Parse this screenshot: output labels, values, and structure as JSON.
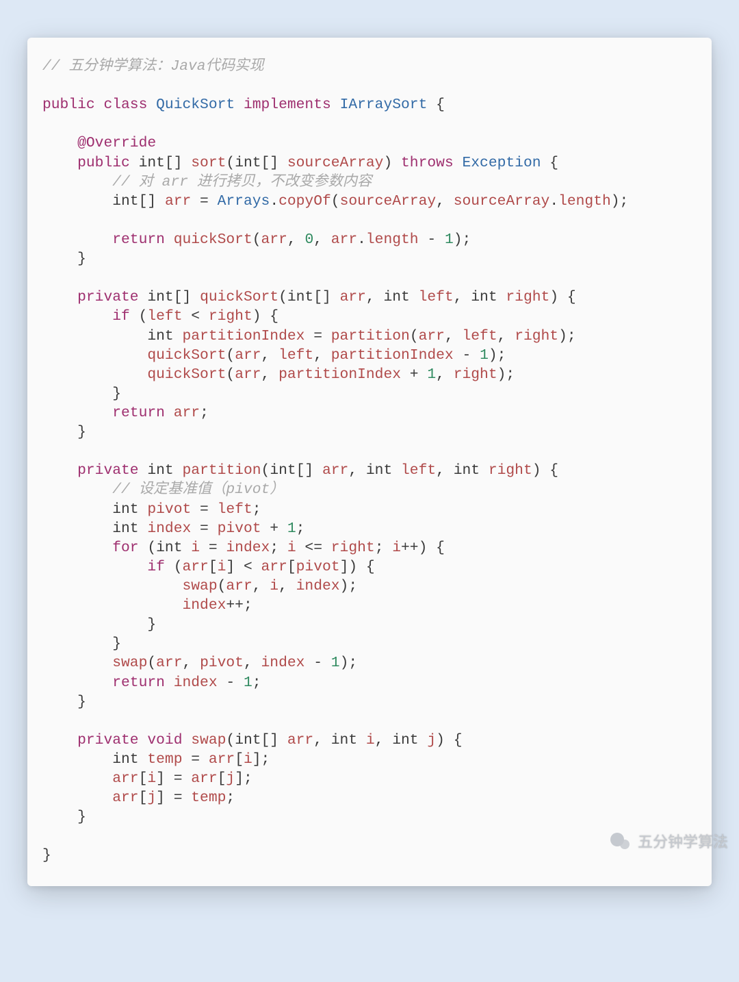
{
  "footer": {
    "brand": "五分钟学算法"
  },
  "code": {
    "lines": [
      [
        {
          "t": "// 五分钟学算法：Java代码实现",
          "c": "cm"
        }
      ],
      [],
      [
        {
          "t": "public",
          "c": "kw"
        },
        {
          "t": " "
        },
        {
          "t": "class",
          "c": "kw"
        },
        {
          "t": " "
        },
        {
          "t": "QuickSort",
          "c": "fn"
        },
        {
          "t": " "
        },
        {
          "t": "implements",
          "c": "kw"
        },
        {
          "t": " "
        },
        {
          "t": "IArraySort",
          "c": "fn"
        },
        {
          "t": " {",
          "c": "op"
        }
      ],
      [],
      [
        {
          "t": "    "
        },
        {
          "t": "@Override",
          "c": "ann"
        }
      ],
      [
        {
          "t": "    "
        },
        {
          "t": "public",
          "c": "kw"
        },
        {
          "t": " "
        },
        {
          "t": "int",
          "c": "ty"
        },
        {
          "t": "[] ",
          "c": "op"
        },
        {
          "t": "sort",
          "c": "fnc"
        },
        {
          "t": "(",
          "c": "op"
        },
        {
          "t": "int",
          "c": "ty"
        },
        {
          "t": "[] ",
          "c": "op"
        },
        {
          "t": "sourceArray",
          "c": "id"
        },
        {
          "t": ") ",
          "c": "op"
        },
        {
          "t": "throws",
          "c": "kw"
        },
        {
          "t": " "
        },
        {
          "t": "Exception",
          "c": "fn"
        },
        {
          "t": " {",
          "c": "op"
        }
      ],
      [
        {
          "t": "        "
        },
        {
          "t": "// 对 arr 进行拷贝，不改变参数内容",
          "c": "cm"
        }
      ],
      [
        {
          "t": "        "
        },
        {
          "t": "int",
          "c": "ty"
        },
        {
          "t": "[] ",
          "c": "op"
        },
        {
          "t": "arr",
          "c": "id"
        },
        {
          "t": " = ",
          "c": "op"
        },
        {
          "t": "Arrays",
          "c": "fn"
        },
        {
          "t": ".",
          "c": "op"
        },
        {
          "t": "copyOf",
          "c": "fnc"
        },
        {
          "t": "(",
          "c": "op"
        },
        {
          "t": "sourceArray",
          "c": "id"
        },
        {
          "t": ", ",
          "c": "op"
        },
        {
          "t": "sourceArray",
          "c": "id"
        },
        {
          "t": ".",
          "c": "op"
        },
        {
          "t": "length",
          "c": "fnc"
        },
        {
          "t": ");",
          "c": "op"
        }
      ],
      [],
      [
        {
          "t": "        "
        },
        {
          "t": "return",
          "c": "kw"
        },
        {
          "t": " "
        },
        {
          "t": "quickSort",
          "c": "fnc"
        },
        {
          "t": "(",
          "c": "op"
        },
        {
          "t": "arr",
          "c": "id"
        },
        {
          "t": ", ",
          "c": "op"
        },
        {
          "t": "0",
          "c": "num"
        },
        {
          "t": ", ",
          "c": "op"
        },
        {
          "t": "arr",
          "c": "id"
        },
        {
          "t": ".",
          "c": "op"
        },
        {
          "t": "length",
          "c": "fnc"
        },
        {
          "t": " - ",
          "c": "op"
        },
        {
          "t": "1",
          "c": "num"
        },
        {
          "t": ");",
          "c": "op"
        }
      ],
      [
        {
          "t": "    }",
          "c": "op"
        }
      ],
      [],
      [
        {
          "t": "    "
        },
        {
          "t": "private",
          "c": "kw"
        },
        {
          "t": " "
        },
        {
          "t": "int",
          "c": "ty"
        },
        {
          "t": "[] ",
          "c": "op"
        },
        {
          "t": "quickSort",
          "c": "fnc"
        },
        {
          "t": "(",
          "c": "op"
        },
        {
          "t": "int",
          "c": "ty"
        },
        {
          "t": "[] ",
          "c": "op"
        },
        {
          "t": "arr",
          "c": "id"
        },
        {
          "t": ", ",
          "c": "op"
        },
        {
          "t": "int",
          "c": "ty"
        },
        {
          "t": " "
        },
        {
          "t": "left",
          "c": "id"
        },
        {
          "t": ", ",
          "c": "op"
        },
        {
          "t": "int",
          "c": "ty"
        },
        {
          "t": " "
        },
        {
          "t": "right",
          "c": "id"
        },
        {
          "t": ") {",
          "c": "op"
        }
      ],
      [
        {
          "t": "        "
        },
        {
          "t": "if",
          "c": "kw"
        },
        {
          "t": " (",
          "c": "op"
        },
        {
          "t": "left",
          "c": "id"
        },
        {
          "t": " < ",
          "c": "op"
        },
        {
          "t": "right",
          "c": "id"
        },
        {
          "t": ") {",
          "c": "op"
        }
      ],
      [
        {
          "t": "            "
        },
        {
          "t": "int",
          "c": "ty"
        },
        {
          "t": " "
        },
        {
          "t": "partitionIndex",
          "c": "id"
        },
        {
          "t": " = ",
          "c": "op"
        },
        {
          "t": "partition",
          "c": "fnc"
        },
        {
          "t": "(",
          "c": "op"
        },
        {
          "t": "arr",
          "c": "id"
        },
        {
          "t": ", ",
          "c": "op"
        },
        {
          "t": "left",
          "c": "id"
        },
        {
          "t": ", ",
          "c": "op"
        },
        {
          "t": "right",
          "c": "id"
        },
        {
          "t": ");",
          "c": "op"
        }
      ],
      [
        {
          "t": "            "
        },
        {
          "t": "quickSort",
          "c": "fnc"
        },
        {
          "t": "(",
          "c": "op"
        },
        {
          "t": "arr",
          "c": "id"
        },
        {
          "t": ", ",
          "c": "op"
        },
        {
          "t": "left",
          "c": "id"
        },
        {
          "t": ", ",
          "c": "op"
        },
        {
          "t": "partitionIndex",
          "c": "id"
        },
        {
          "t": " - ",
          "c": "op"
        },
        {
          "t": "1",
          "c": "num"
        },
        {
          "t": ");",
          "c": "op"
        }
      ],
      [
        {
          "t": "            "
        },
        {
          "t": "quickSort",
          "c": "fnc"
        },
        {
          "t": "(",
          "c": "op"
        },
        {
          "t": "arr",
          "c": "id"
        },
        {
          "t": ", ",
          "c": "op"
        },
        {
          "t": "partitionIndex",
          "c": "id"
        },
        {
          "t": " + ",
          "c": "op"
        },
        {
          "t": "1",
          "c": "num"
        },
        {
          "t": ", ",
          "c": "op"
        },
        {
          "t": "right",
          "c": "id"
        },
        {
          "t": ");",
          "c": "op"
        }
      ],
      [
        {
          "t": "        }",
          "c": "op"
        }
      ],
      [
        {
          "t": "        "
        },
        {
          "t": "return",
          "c": "kw"
        },
        {
          "t": " "
        },
        {
          "t": "arr",
          "c": "id"
        },
        {
          "t": ";",
          "c": "op"
        }
      ],
      [
        {
          "t": "    }",
          "c": "op"
        }
      ],
      [],
      [
        {
          "t": "    "
        },
        {
          "t": "private",
          "c": "kw"
        },
        {
          "t": " "
        },
        {
          "t": "int",
          "c": "ty"
        },
        {
          "t": " "
        },
        {
          "t": "partition",
          "c": "fnc"
        },
        {
          "t": "(",
          "c": "op"
        },
        {
          "t": "int",
          "c": "ty"
        },
        {
          "t": "[] ",
          "c": "op"
        },
        {
          "t": "arr",
          "c": "id"
        },
        {
          "t": ", ",
          "c": "op"
        },
        {
          "t": "int",
          "c": "ty"
        },
        {
          "t": " "
        },
        {
          "t": "left",
          "c": "id"
        },
        {
          "t": ", ",
          "c": "op"
        },
        {
          "t": "int",
          "c": "ty"
        },
        {
          "t": " "
        },
        {
          "t": "right",
          "c": "id"
        },
        {
          "t": ") {",
          "c": "op"
        }
      ],
      [
        {
          "t": "        "
        },
        {
          "t": "// 设定基准值（pivot）",
          "c": "cm"
        }
      ],
      [
        {
          "t": "        "
        },
        {
          "t": "int",
          "c": "ty"
        },
        {
          "t": " "
        },
        {
          "t": "pivot",
          "c": "id"
        },
        {
          "t": " = ",
          "c": "op"
        },
        {
          "t": "left",
          "c": "id"
        },
        {
          "t": ";",
          "c": "op"
        }
      ],
      [
        {
          "t": "        "
        },
        {
          "t": "int",
          "c": "ty"
        },
        {
          "t": " "
        },
        {
          "t": "index",
          "c": "id"
        },
        {
          "t": " = ",
          "c": "op"
        },
        {
          "t": "pivot",
          "c": "id"
        },
        {
          "t": " + ",
          "c": "op"
        },
        {
          "t": "1",
          "c": "num"
        },
        {
          "t": ";",
          "c": "op"
        }
      ],
      [
        {
          "t": "        "
        },
        {
          "t": "for",
          "c": "kw"
        },
        {
          "t": " (",
          "c": "op"
        },
        {
          "t": "int",
          "c": "ty"
        },
        {
          "t": " "
        },
        {
          "t": "i",
          "c": "id"
        },
        {
          "t": " = ",
          "c": "op"
        },
        {
          "t": "index",
          "c": "id"
        },
        {
          "t": "; ",
          "c": "op"
        },
        {
          "t": "i",
          "c": "id"
        },
        {
          "t": " <= ",
          "c": "op"
        },
        {
          "t": "right",
          "c": "id"
        },
        {
          "t": "; ",
          "c": "op"
        },
        {
          "t": "i",
          "c": "id"
        },
        {
          "t": "++",
          "c": "op"
        },
        {
          "t": ") {",
          "c": "op"
        }
      ],
      [
        {
          "t": "            "
        },
        {
          "t": "if",
          "c": "kw"
        },
        {
          "t": " (",
          "c": "op"
        },
        {
          "t": "arr",
          "c": "id"
        },
        {
          "t": "[",
          "c": "op"
        },
        {
          "t": "i",
          "c": "id"
        },
        {
          "t": "] < ",
          "c": "op"
        },
        {
          "t": "arr",
          "c": "id"
        },
        {
          "t": "[",
          "c": "op"
        },
        {
          "t": "pivot",
          "c": "id"
        },
        {
          "t": "]) {",
          "c": "op"
        }
      ],
      [
        {
          "t": "                "
        },
        {
          "t": "swap",
          "c": "fnc"
        },
        {
          "t": "(",
          "c": "op"
        },
        {
          "t": "arr",
          "c": "id"
        },
        {
          "t": ", ",
          "c": "op"
        },
        {
          "t": "i",
          "c": "id"
        },
        {
          "t": ", ",
          "c": "op"
        },
        {
          "t": "index",
          "c": "id"
        },
        {
          "t": ");",
          "c": "op"
        }
      ],
      [
        {
          "t": "                "
        },
        {
          "t": "index",
          "c": "id"
        },
        {
          "t": "++;",
          "c": "op"
        }
      ],
      [
        {
          "t": "            }",
          "c": "op"
        }
      ],
      [
        {
          "t": "        }",
          "c": "op"
        }
      ],
      [
        {
          "t": "        "
        },
        {
          "t": "swap",
          "c": "fnc"
        },
        {
          "t": "(",
          "c": "op"
        },
        {
          "t": "arr",
          "c": "id"
        },
        {
          "t": ", ",
          "c": "op"
        },
        {
          "t": "pivot",
          "c": "id"
        },
        {
          "t": ", ",
          "c": "op"
        },
        {
          "t": "index",
          "c": "id"
        },
        {
          "t": " - ",
          "c": "op"
        },
        {
          "t": "1",
          "c": "num"
        },
        {
          "t": ");",
          "c": "op"
        }
      ],
      [
        {
          "t": "        "
        },
        {
          "t": "return",
          "c": "kw"
        },
        {
          "t": " "
        },
        {
          "t": "index",
          "c": "id"
        },
        {
          "t": " - ",
          "c": "op"
        },
        {
          "t": "1",
          "c": "num"
        },
        {
          "t": ";",
          "c": "op"
        }
      ],
      [
        {
          "t": "    }",
          "c": "op"
        }
      ],
      [],
      [
        {
          "t": "    "
        },
        {
          "t": "private",
          "c": "kw"
        },
        {
          "t": " "
        },
        {
          "t": "void",
          "c": "kw"
        },
        {
          "t": " "
        },
        {
          "t": "swap",
          "c": "fnc"
        },
        {
          "t": "(",
          "c": "op"
        },
        {
          "t": "int",
          "c": "ty"
        },
        {
          "t": "[] ",
          "c": "op"
        },
        {
          "t": "arr",
          "c": "id"
        },
        {
          "t": ", ",
          "c": "op"
        },
        {
          "t": "int",
          "c": "ty"
        },
        {
          "t": " "
        },
        {
          "t": "i",
          "c": "id"
        },
        {
          "t": ", ",
          "c": "op"
        },
        {
          "t": "int",
          "c": "ty"
        },
        {
          "t": " "
        },
        {
          "t": "j",
          "c": "id"
        },
        {
          "t": ") {",
          "c": "op"
        }
      ],
      [
        {
          "t": "        "
        },
        {
          "t": "int",
          "c": "ty"
        },
        {
          "t": " "
        },
        {
          "t": "temp",
          "c": "id"
        },
        {
          "t": " = ",
          "c": "op"
        },
        {
          "t": "arr",
          "c": "id"
        },
        {
          "t": "[",
          "c": "op"
        },
        {
          "t": "i",
          "c": "id"
        },
        {
          "t": "];",
          "c": "op"
        }
      ],
      [
        {
          "t": "        "
        },
        {
          "t": "arr",
          "c": "id"
        },
        {
          "t": "[",
          "c": "op"
        },
        {
          "t": "i",
          "c": "id"
        },
        {
          "t": "] = ",
          "c": "op"
        },
        {
          "t": "arr",
          "c": "id"
        },
        {
          "t": "[",
          "c": "op"
        },
        {
          "t": "j",
          "c": "id"
        },
        {
          "t": "];",
          "c": "op"
        }
      ],
      [
        {
          "t": "        "
        },
        {
          "t": "arr",
          "c": "id"
        },
        {
          "t": "[",
          "c": "op"
        },
        {
          "t": "j",
          "c": "id"
        },
        {
          "t": "] = ",
          "c": "op"
        },
        {
          "t": "temp",
          "c": "id"
        },
        {
          "t": ";",
          "c": "op"
        }
      ],
      [
        {
          "t": "    }",
          "c": "op"
        }
      ],
      [],
      [
        {
          "t": "}",
          "c": "op"
        }
      ]
    ]
  }
}
